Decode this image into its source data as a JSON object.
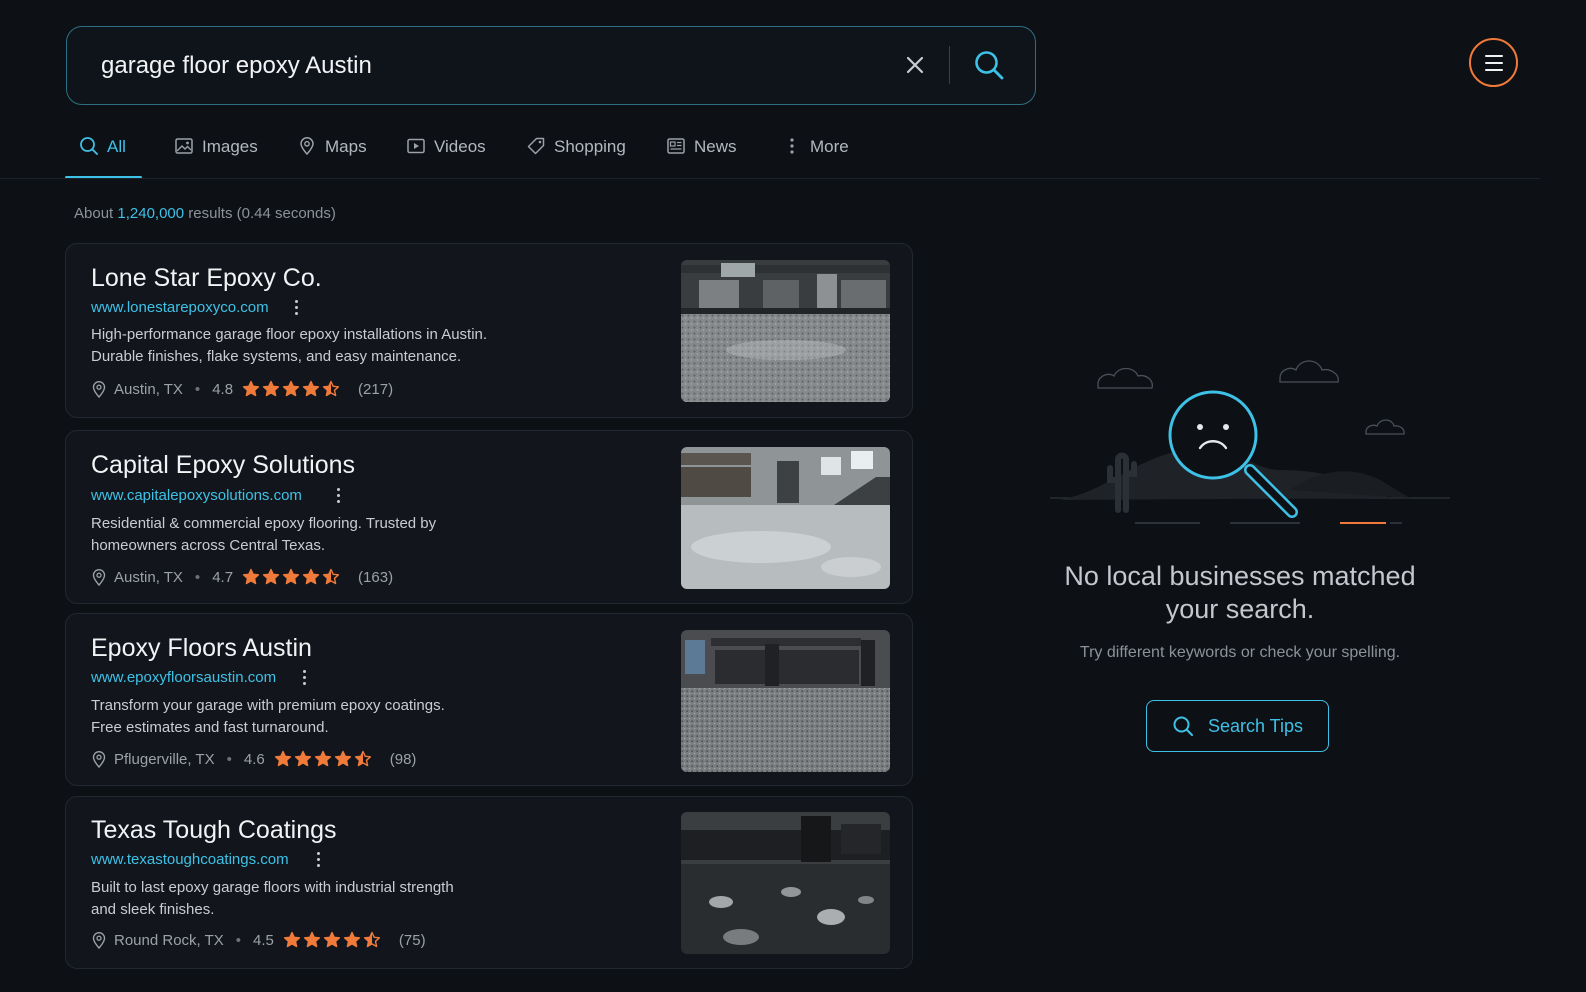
{
  "search": {
    "query": "garage floor epoxy Austin",
    "clear_icon": "close-icon",
    "submit_icon": "search-icon"
  },
  "menu": {
    "icon": "hamburger-menu-icon",
    "accent_color": "#f07a3a"
  },
  "tabs": [
    {
      "label": "All",
      "icon": "search-icon",
      "active": true
    },
    {
      "label": "Images",
      "icon": "image-icon"
    },
    {
      "label": "Maps",
      "icon": "map-pin-icon"
    },
    {
      "label": "Videos",
      "icon": "video-icon"
    },
    {
      "label": "Shopping",
      "icon": "tag-icon"
    },
    {
      "label": "News",
      "icon": "newspaper-icon"
    },
    {
      "label": "More",
      "icon": "more-vertical-icon"
    }
  ],
  "stats": {
    "prefix": "About",
    "count": "1,240,000",
    "suffix": "results (0.44 seconds)"
  },
  "results": [
    {
      "title": "Lone Star Epoxy Co.",
      "url": "www.lonestarepoxyco.com",
      "desc_line1": "High-performance garage floor epoxy installations in Austin.",
      "desc_line2": "Durable finishes, flake systems, and easy maintenance.",
      "location": "Austin, TX",
      "rating": "4.8",
      "rating_value": 4.5,
      "reviews": "(217)"
    },
    {
      "title": "Capital Epoxy Solutions",
      "url": "www.capitalepoxysolutions.com",
      "desc_line1": "Residential & commercial epoxy flooring. Trusted by",
      "desc_line2": "homeowners across Central Texas.",
      "location": "Austin, TX",
      "rating": "4.7",
      "rating_value": 4.5,
      "reviews": "(163)"
    },
    {
      "title": "Epoxy Floors Austin",
      "url": "www.epoxyfloorsaustin.com",
      "desc_line1": "Transform your garage with premium epoxy coatings.",
      "desc_line2": "Free estimates and fast turnaround.",
      "location": "Pflugerville, TX",
      "rating": "4.6",
      "rating_value": 4.5,
      "reviews": "(98)"
    },
    {
      "title": "Texas Tough Coatings",
      "url": "www.texastoughcoatings.com",
      "desc_line1": "Built to last epoxy garage floors with industrial strength",
      "desc_line2": "and sleek finishes.",
      "location": "Round Rock, TX",
      "rating": "4.5",
      "rating_value": 4.5,
      "reviews": "(75)"
    }
  ],
  "empty_state": {
    "title_line1": "No local businesses matched",
    "title_line2": "your search.",
    "subtitle": "Try different keywords or check your spelling.",
    "button_label": "Search Tips",
    "illustration": "sad-magnifier-illustration"
  },
  "colors": {
    "accent": "#3ec1e6",
    "star": "#f07a3a",
    "background": "#0d1015",
    "card": "#12161c"
  }
}
